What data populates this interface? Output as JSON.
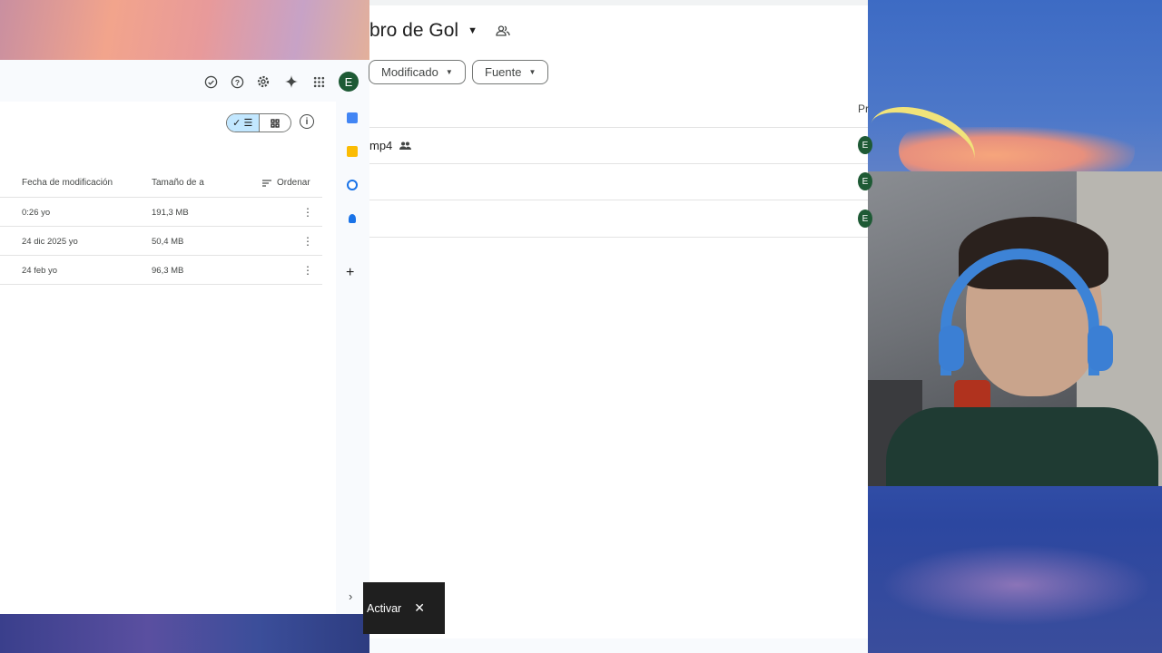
{
  "left_panel": {
    "view_toggle": {
      "list_icon": "check-list-icon",
      "grid_icon": "grid-icon"
    },
    "columns": {
      "modified": "Fecha de modificación",
      "size": "Tamaño de a",
      "sort": "Ordenar"
    },
    "rows": [
      {
        "modified": "0:26 yo",
        "size": "191,3 MB"
      },
      {
        "modified": "24 dic 2025 yo",
        "size": "50,4 MB"
      },
      {
        "modified": "24 feb yo",
        "size": "96,3 MB"
      }
    ],
    "avatar_letter": "E",
    "topbar_icons": [
      "offline-ready-icon",
      "help-icon",
      "settings-icon",
      "gemini-spark-icon",
      "apps-grid-icon"
    ],
    "rail_icons": [
      "calendar-icon",
      "keep-icon",
      "tasks-icon",
      "contacts-icon",
      "add-icon"
    ],
    "rail_expand": "›"
  },
  "center_panel": {
    "title": "bro de Gol",
    "filters": [
      "Modificado",
      "Fuente"
    ],
    "column_owner_partial": "Pr",
    "rows": [
      {
        "name": "mp4",
        "shared": true,
        "owner": "E"
      },
      {
        "name": "",
        "shared": false,
        "owner": "E"
      },
      {
        "name": "",
        "shared": false,
        "owner": "E"
      }
    ],
    "snackbar": {
      "action": "Activar",
      "close": "✕"
    }
  },
  "colors": {
    "accent_selected": "#c2e7ff",
    "avatar": "#1e5a35"
  }
}
